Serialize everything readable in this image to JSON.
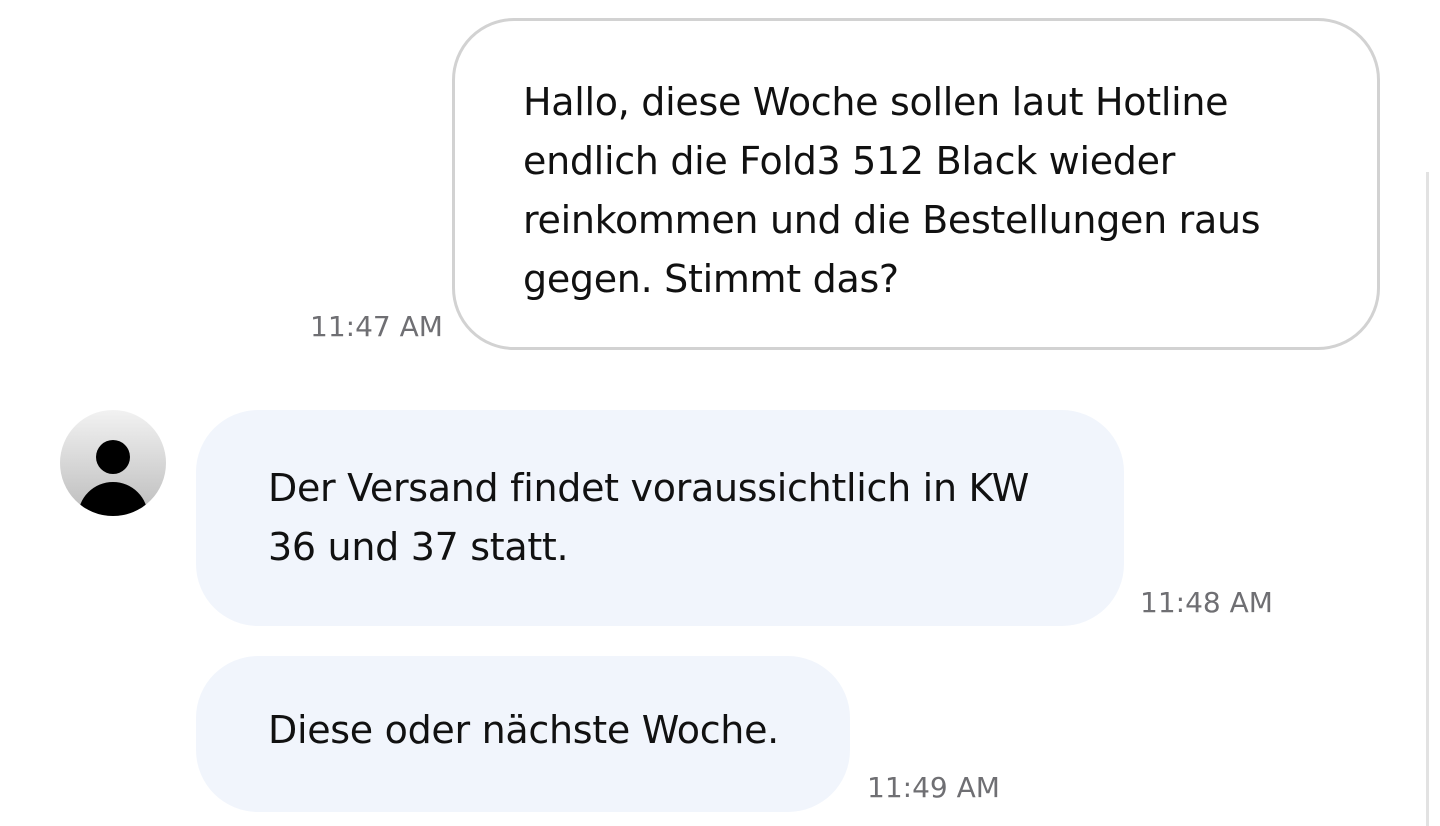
{
  "conversation": {
    "messages": [
      {
        "direction": "outgoing",
        "text": "Hallo, diese Woche sollen laut Hotline\nendlich die Fold3 512 Black wieder\nreinkommen und die Bestellungen raus\ngegen. Stimmt das?",
        "time": "11:47 AM"
      },
      {
        "direction": "incoming",
        "text": "Der Versand findet voraussichtlich in KW\n36 und 37 statt.",
        "time": "11:48 AM"
      },
      {
        "direction": "incoming",
        "text": "Diese oder nächste Woche.",
        "time": "11:49 AM"
      }
    ],
    "contact": {
      "avatar_icon": "person-icon"
    }
  },
  "colors": {
    "incoming_bubble": "#f1f5fc",
    "outgoing_bubble_border": "#d2d2d2",
    "timestamp": "#6f6f73",
    "text": "#111111"
  }
}
